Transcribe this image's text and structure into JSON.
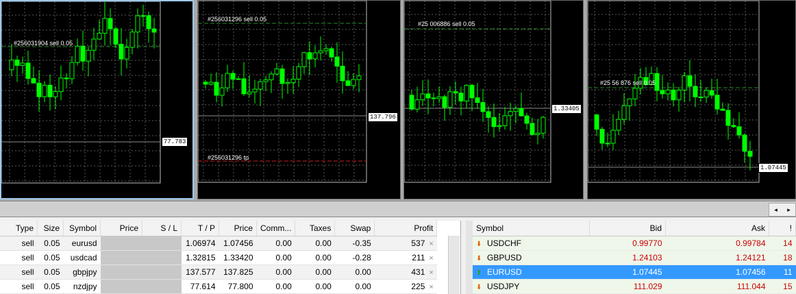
{
  "charts": [
    {
      "order_label": "#256031904 sell 0.05",
      "order_label2": "",
      "price_tag": "77.783"
    },
    {
      "order_label": "#256031296 sell 0.05",
      "order_label2": "#256031296 tp",
      "price_tag": "137.796"
    },
    {
      "order_label": "#25 006886 sell 0.05",
      "order_label2": "",
      "price_tag": "1.33405"
    },
    {
      "order_label": "#25 56 876 sell 0.05",
      "order_label2": "",
      "price_tag": "1.07445"
    }
  ],
  "scroll": {
    "left_arrow": "◂",
    "right_arrow": "▸"
  },
  "trade": {
    "headers": [
      "Type",
      "Size",
      "Symbol",
      "Price",
      "S / L",
      "T / P",
      "Price",
      "Comm...",
      "Taxes",
      "Swap",
      "Profit"
    ],
    "rows": [
      {
        "type": "sell",
        "size": "0.05",
        "symbol": "eurusd",
        "tp": "1.06974",
        "price": "1.07456",
        "comm": "0.00",
        "taxes": "0.00",
        "swap": "-0.35",
        "profit": "537",
        "close": "×"
      },
      {
        "type": "sell",
        "size": "0.05",
        "symbol": "usdcad",
        "tp": "1.32815",
        "price": "1.33420",
        "comm": "0.00",
        "taxes": "0.00",
        "swap": "-0.28",
        "profit": "211",
        "close": "×"
      },
      {
        "type": "sell",
        "size": "0.05",
        "symbol": "gbpjpy",
        "tp": "137.577",
        "price": "137.825",
        "comm": "0.00",
        "taxes": "0.00",
        "swap": "0.00",
        "profit": "431",
        "close": "×"
      },
      {
        "type": "sell",
        "size": "0.05",
        "symbol": "nzdjpy",
        "tp": "77.614",
        "price": "77.800",
        "comm": "0.00",
        "taxes": "0.00",
        "swap": "0.00",
        "profit": "225",
        "close": "×"
      }
    ]
  },
  "watch": {
    "headers": {
      "symbol": "Symbol",
      "bid": "Bid",
      "ask": "Ask",
      "spread": "!"
    },
    "rows": [
      {
        "symbol": "USDCHF",
        "bid": "0.99770",
        "ask": "0.99784",
        "spread": "14",
        "dir": "down"
      },
      {
        "symbol": "GBPUSD",
        "bid": "1.24103",
        "ask": "1.24121",
        "spread": "18",
        "dir": "down"
      },
      {
        "symbol": "EURUSD",
        "bid": "1.07445",
        "ask": "1.07456",
        "spread": "11",
        "dir": "up",
        "selected": true
      },
      {
        "symbol": "USDJPY",
        "bid": "111.029",
        "ask": "111.044",
        "spread": "15",
        "dir": "down"
      }
    ]
  },
  "colors": {
    "candle": "#00ff00",
    "grid": "#5a5a5a",
    "loss_line": "#d02020",
    "order_line": "#2b8a2b",
    "selection": "#3399ff",
    "price_red": "#cc0000"
  }
}
